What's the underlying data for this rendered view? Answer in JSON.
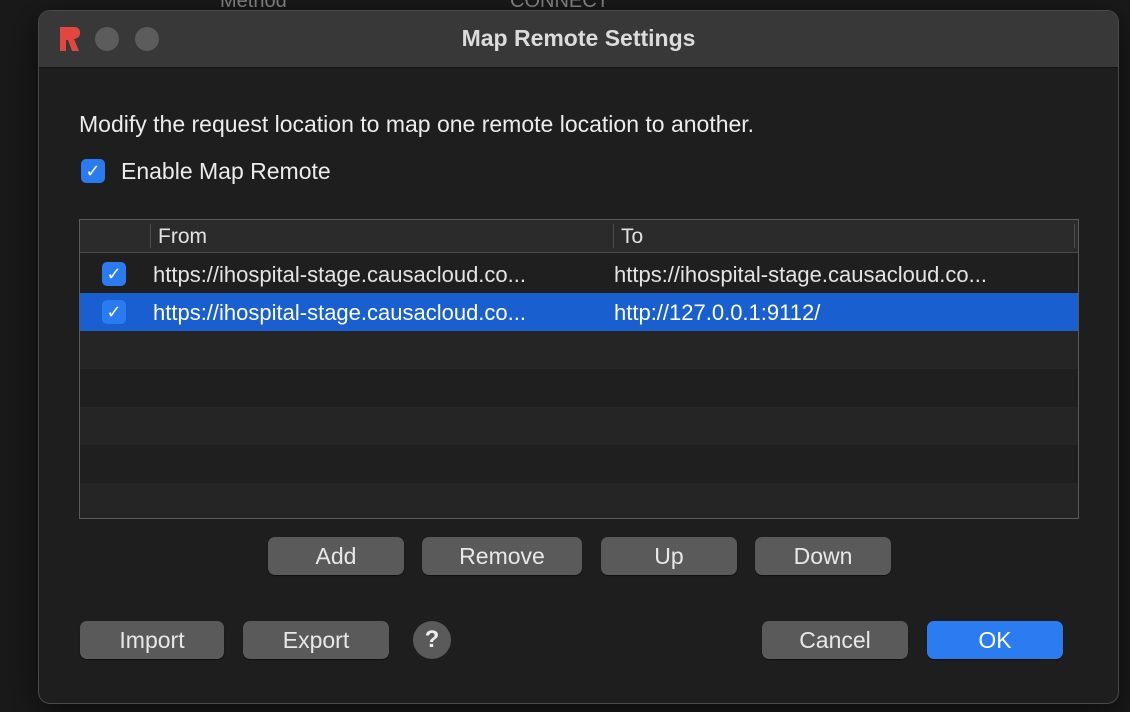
{
  "background": {
    "header_left": "Method",
    "header_right": "CONNECT"
  },
  "window": {
    "title": "Map Remote Settings"
  },
  "description": "Modify the request location to map one remote location to another.",
  "enable": {
    "label": "Enable Map Remote",
    "checked": true
  },
  "table": {
    "columns": [
      "From",
      "To"
    ],
    "rows": [
      {
        "enabled": true,
        "from": "https://ihospital-stage.causacloud.co...",
        "to": "https://ihospital-stage.causacloud.co...",
        "selected": false
      },
      {
        "enabled": true,
        "from": "https://ihospital-stage.causacloud.co...",
        "to": "http://127.0.0.1:9112/",
        "selected": true
      }
    ]
  },
  "buttons": {
    "add": "Add",
    "remove": "Remove",
    "up": "Up",
    "down": "Down",
    "import": "Import",
    "export": "Export",
    "help": "?",
    "cancel": "Cancel",
    "ok": "OK"
  },
  "colors": {
    "accent": "#2b7cf0",
    "selection": "#1a5fcf",
    "close": "#e2463f"
  }
}
